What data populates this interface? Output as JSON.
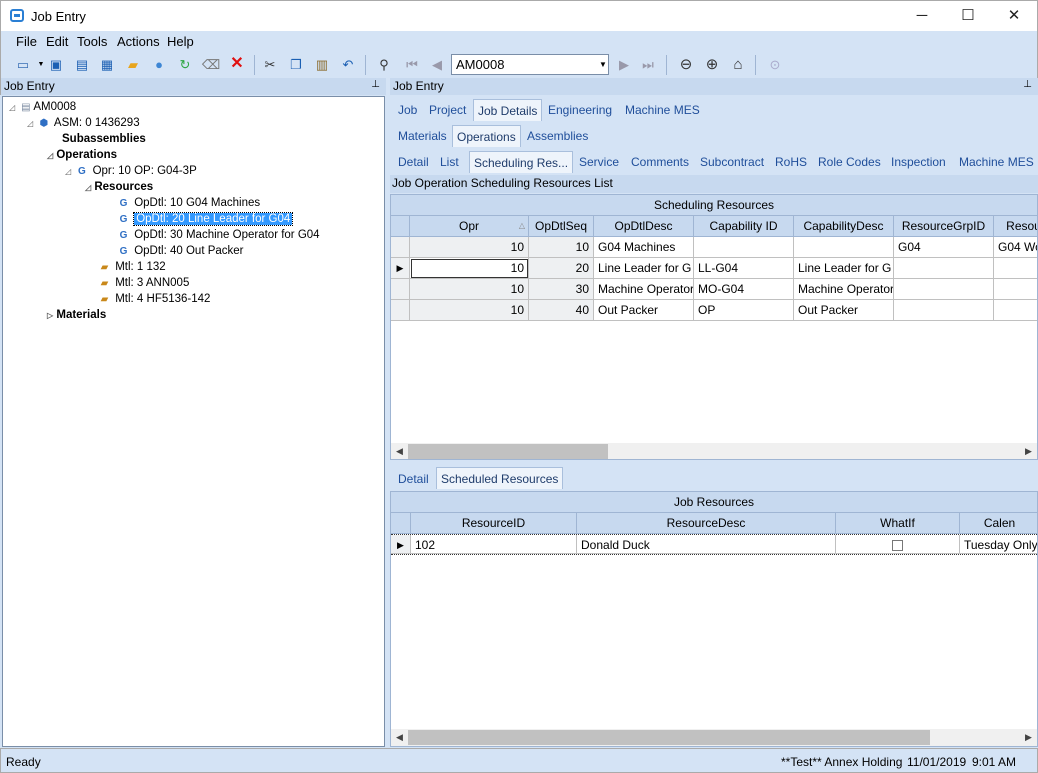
{
  "window": {
    "title": "Job Entry",
    "minimize": "─",
    "maximize": "☐",
    "close": "✕"
  },
  "menu": [
    "File",
    "Edit",
    "Tools",
    "Actions",
    "Help"
  ],
  "toolbar": {
    "job_value": "AM0008"
  },
  "left_panel": {
    "title": "Job Entry",
    "pin": "📌"
  },
  "tree": {
    "root": "AM0008",
    "asm": "ASM: 0 1436293",
    "subassemblies": "Subassemblies",
    "operations": "Operations",
    "opr": "Opr: 10 OP: G04-3P",
    "resources": "Resources",
    "opdtls": [
      "OpDtl: 10 G04 Machines",
      "OpDtl: 20 Line Leader for G04",
      "OpDtl: 30 Machine Operator for G04",
      "OpDtl: 40 Out Packer"
    ],
    "mtls": [
      "Mtl: 1 132",
      "Mtl: 3 ANN005",
      "Mtl: 4 HF5136-142"
    ],
    "materials": "Materials"
  },
  "right_panel": {
    "title": "Job Entry"
  },
  "tabs1": [
    "Job",
    "Project",
    "Job Details",
    "Engineering",
    "Machine MES"
  ],
  "tabs2": [
    "Materials",
    "Operations",
    "Assemblies"
  ],
  "tabs3": [
    "Detail",
    "List",
    "Scheduling Res...",
    "Service",
    "Comments",
    "Subcontract",
    "RoHS",
    "Role Codes",
    "Inspection",
    "Machine MES"
  ],
  "list_title": "Job Operation Scheduling Resources List",
  "grid1": {
    "caption": "Scheduling Resources",
    "headers": [
      "Opr",
      "OpDtlSeq",
      "OpDtlDesc",
      "Capability ID",
      "CapabilityDesc",
      "ResourceGrpID",
      "Resou"
    ],
    "rows": [
      [
        "10",
        "10",
        "G04 Machines",
        "",
        "",
        "G04",
        "G04 Wo"
      ],
      [
        "10",
        "20",
        "Line Leader for G",
        "LL-G04",
        "Line Leader for G",
        "",
        ""
      ],
      [
        "10",
        "30",
        "Machine Operator",
        "MO-G04",
        "Machine Operator",
        "",
        ""
      ],
      [
        "10",
        "40",
        "Out Packer",
        "OP",
        "Out Packer",
        "",
        ""
      ]
    ]
  },
  "lower_tabs": [
    "Detail",
    "Scheduled Resources"
  ],
  "grid2": {
    "caption": "Job Resources",
    "headers": [
      "ResourceID",
      "ResourceDesc",
      "WhatIf",
      "Calen"
    ],
    "rows": [
      [
        "102",
        "Donald Duck",
        "",
        "Tuesday Only"
      ]
    ]
  },
  "status": {
    "left": "Ready",
    "company": "**Test** Annex Holding",
    "date": "11/01/2019",
    "time": "9:01 AM"
  },
  "colors": {
    "accent": "#3399ff",
    "panel": "#d4e3f5",
    "header": "#c7d9ef"
  }
}
